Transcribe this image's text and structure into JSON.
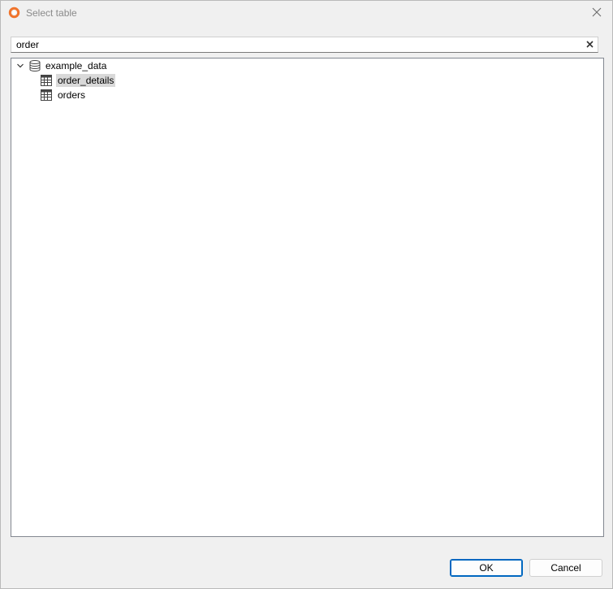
{
  "window": {
    "title": "Select table",
    "app_icon": "app-ring-icon",
    "accent_color": "#f0742c"
  },
  "search": {
    "value": "order",
    "clear_icon": "clear-x-icon"
  },
  "tree": {
    "root": {
      "label": "example_data",
      "icon": "database-icon",
      "expanded": true,
      "children": [
        {
          "label": "order_details",
          "icon": "table-icon",
          "selected": true
        },
        {
          "label": "orders",
          "icon": "table-icon",
          "selected": false
        }
      ]
    }
  },
  "buttons": {
    "ok_label": "OK",
    "cancel_label": "Cancel"
  }
}
